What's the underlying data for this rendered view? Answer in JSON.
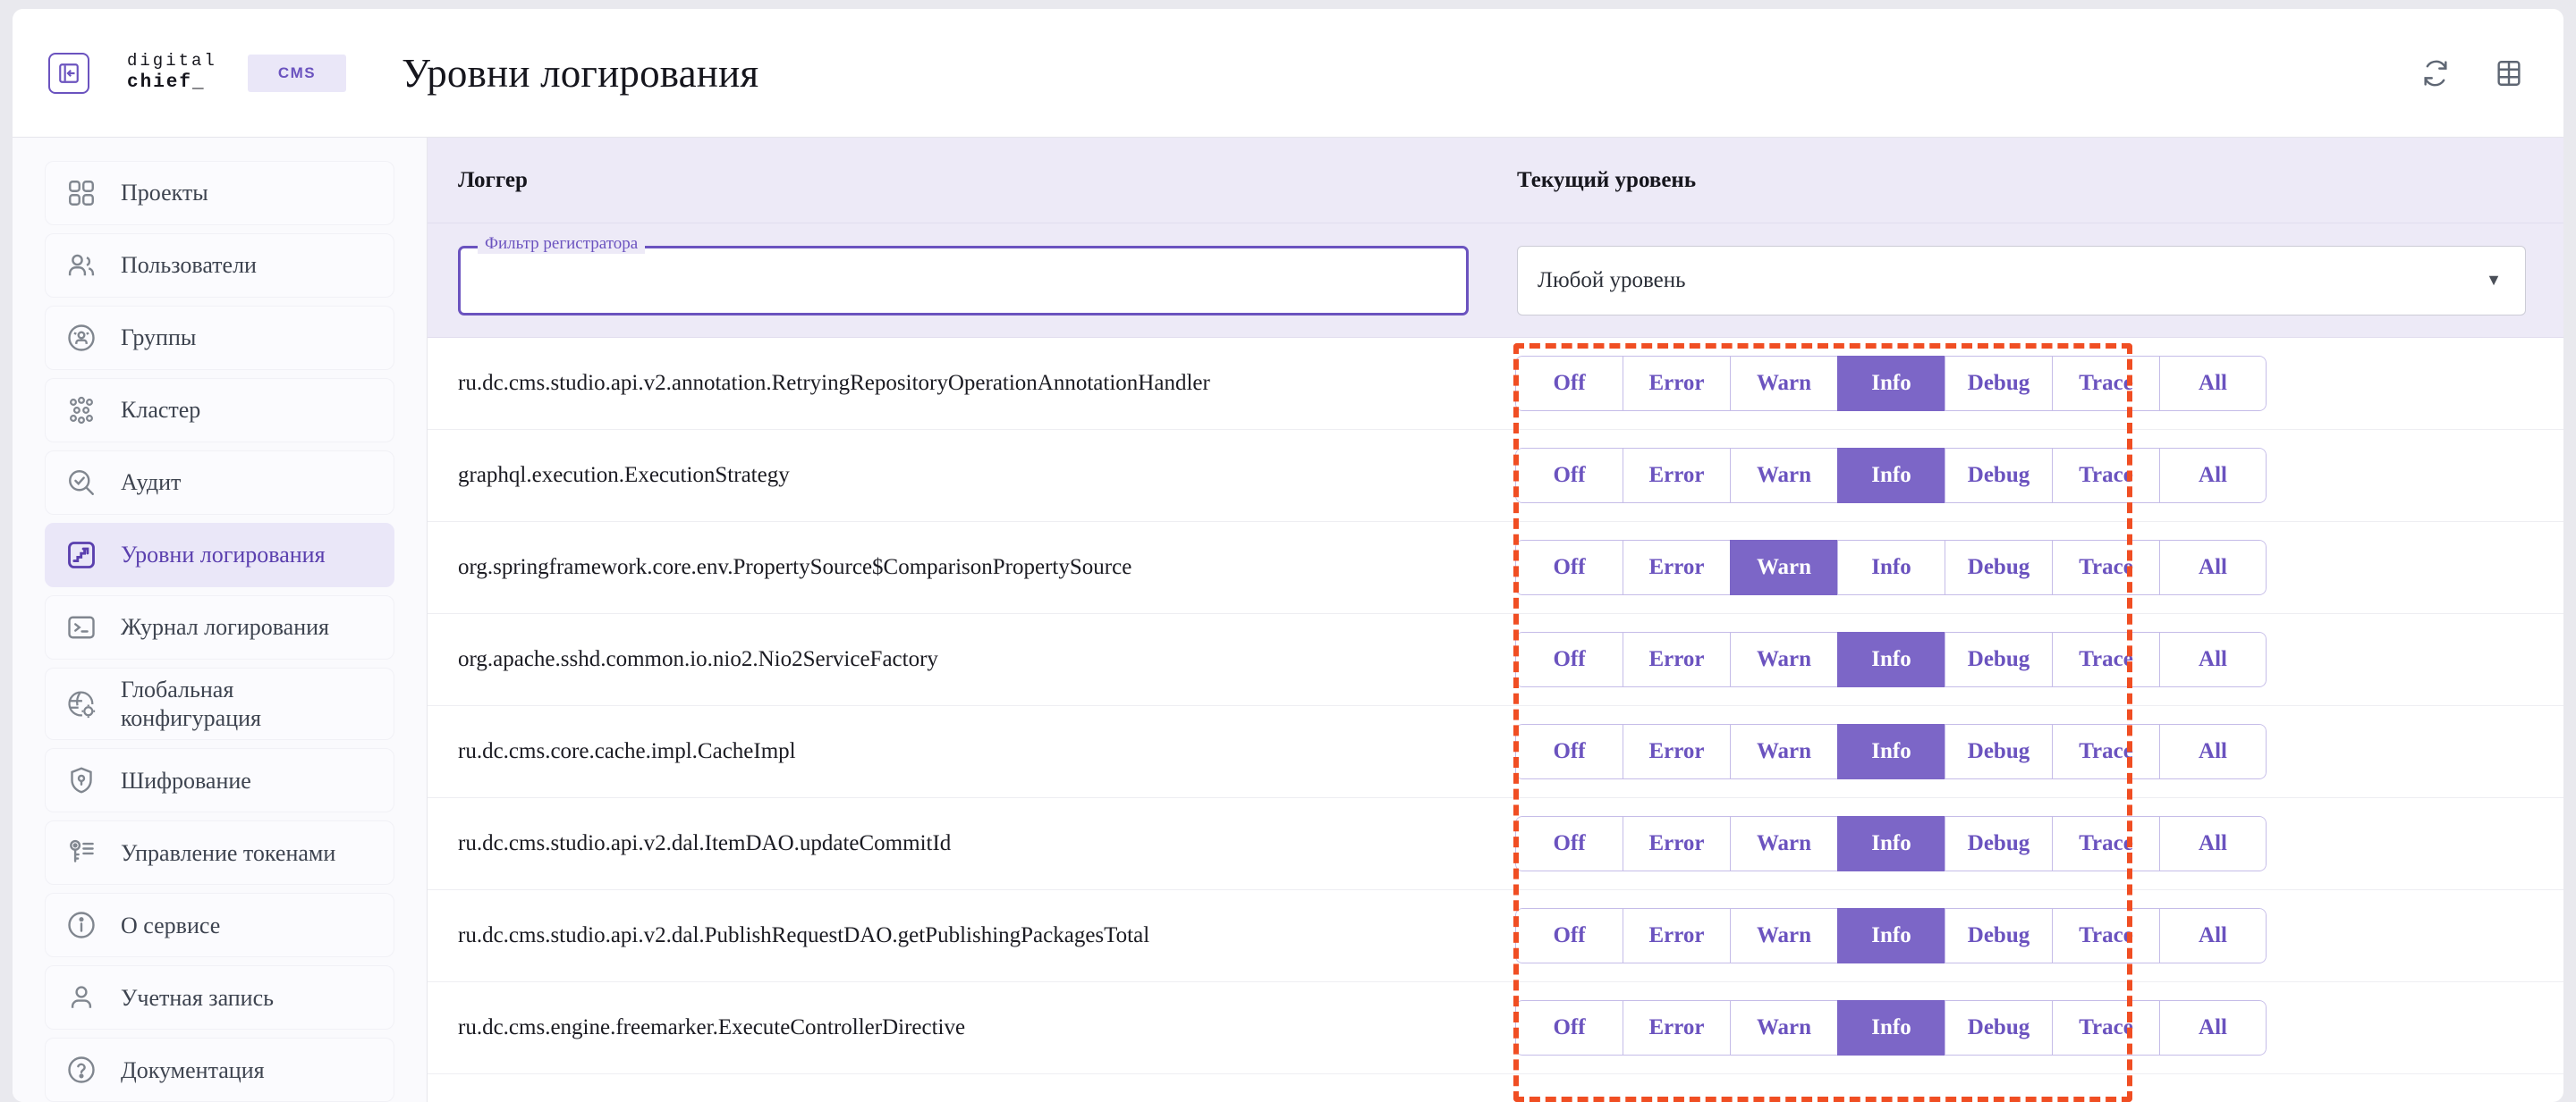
{
  "topbar": {
    "collapse_icon": "collapse-panel-icon",
    "brand_line1": "digital",
    "brand_line2": "chief_",
    "brand_chip": "CMS",
    "page_title": "Уровни логирования",
    "refresh_icon": "refresh-icon",
    "grid_icon": "table-grid-icon"
  },
  "sidebar": {
    "items": [
      {
        "label": "Проекты",
        "icon": "grid-squares-icon",
        "active": false
      },
      {
        "label": "Пользователи",
        "icon": "users-icon",
        "active": false
      },
      {
        "label": "Группы",
        "icon": "group-circle-icon",
        "active": false
      },
      {
        "label": "Кластер",
        "icon": "cluster-dots-icon",
        "active": false
      },
      {
        "label": "Аудит",
        "icon": "audit-search-icon",
        "active": false
      },
      {
        "label": "Уровни логирования",
        "icon": "log-levels-icon",
        "active": true
      },
      {
        "label": "Журнал логирования",
        "icon": "terminal-icon",
        "active": false
      },
      {
        "label": "Глобальная\nконфигурация",
        "icon": "globe-gear-icon",
        "active": false
      },
      {
        "label": "Шифрование",
        "icon": "shield-lock-icon",
        "active": false
      },
      {
        "label": "Управление токенами",
        "icon": "key-list-icon",
        "active": false
      },
      {
        "label": "О сервисе",
        "icon": "info-circle-icon",
        "active": false
      },
      {
        "label": "Учетная запись",
        "icon": "person-icon",
        "active": false
      },
      {
        "label": "Документация",
        "icon": "question-circle-icon",
        "active": false
      }
    ]
  },
  "table": {
    "headers": {
      "logger": "Логгер",
      "level": "Текущий уровень"
    },
    "filter": {
      "label": "Фильтр регистратора",
      "value": "",
      "placeholder": ""
    },
    "level_select": {
      "value": "Любой уровень",
      "caret_icon": "chevron-down-icon"
    },
    "level_options": [
      "Off",
      "Error",
      "Warn",
      "Info",
      "Debug",
      "Trace",
      "All"
    ],
    "rows": [
      {
        "logger": "ru.dc.cms.studio.api.v2.annotation.RetryingRepositoryOperationAnnotationHandler",
        "level": "Info"
      },
      {
        "logger": "graphql.execution.ExecutionStrategy",
        "level": "Info"
      },
      {
        "logger": "org.springframework.core.env.PropertySource$ComparisonPropertySource",
        "level": "Warn"
      },
      {
        "logger": "org.apache.sshd.common.io.nio2.Nio2ServiceFactory",
        "level": "Info"
      },
      {
        "logger": "ru.dc.cms.core.cache.impl.CacheImpl",
        "level": "Info"
      },
      {
        "logger": "ru.dc.cms.studio.api.v2.dal.ItemDAO.updateCommitId",
        "level": "Info"
      },
      {
        "logger": "ru.dc.cms.studio.api.v2.dal.PublishRequestDAO.getPublishingPackagesTotal",
        "level": "Info"
      },
      {
        "logger": "ru.dc.cms.engine.freemarker.ExecuteControllerDirective",
        "level": "Info"
      }
    ]
  },
  "colors": {
    "accent_purple": "#6b53bf",
    "selected_purple": "#7c66c7",
    "header_band": "#edeaf7",
    "annotation_orange": "#f04e23"
  }
}
